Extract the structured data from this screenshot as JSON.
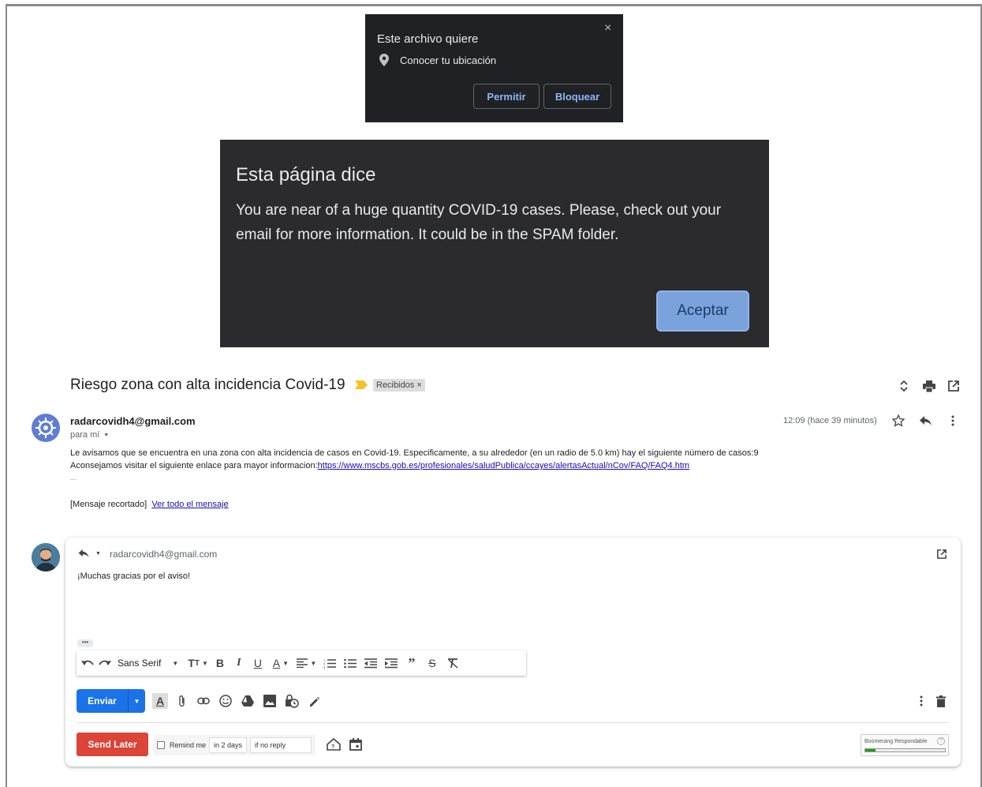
{
  "permission_popup": {
    "title": "Este archivo quiere",
    "request": "Conocer tu ubicación",
    "allow_label": "Permitir",
    "block_label": "Bloquear",
    "close_glyph": "×"
  },
  "alert_dialog": {
    "title": "Esta página dice",
    "message": "You are near of a huge quantity COVID-19 cases. Please, check out your email for more information. It could be in the SPAM folder.",
    "ok_label": "Aceptar",
    "button_color": "#7aa3dc"
  },
  "email": {
    "subject": "Riesgo zona con alta incidencia Covid-19",
    "label": "Recibidos ×",
    "sender": "radarcovidh4@gmail.com",
    "to": "para mí",
    "time": "12:09 (hace 39 minutos)",
    "body_line1": "Le avisamos que se encuentra en una zona con alta incidencia de casos en Covid-19. Especificamente, a su alrededor (en un radio de 5.0 km) hay el siguiente número de casos:9",
    "body_line2_prefix": "Aconsejamos visitar el siguiente enlace para mayor informacion:",
    "body_link": "https://www.mscbs.gob.es/profesionales/saludPublica/ccayes/alertasActual/nCov/FAQ/FAQ4.htm",
    "ellipsis": "...",
    "clipped_prefix": "[Mensaje recortado]",
    "view_all_link": "Ver todo el mensaje",
    "important_color": "#f6c026"
  },
  "reply": {
    "to": "radarcovidh4@gmail.com",
    "text": "¡Muchas gracias por el aviso!",
    "more_dots": "•••",
    "font_name": "Sans Serif",
    "send_label": "Enviar",
    "send_later_label": "Send Later",
    "remind_label": "Remind me",
    "remind_days": "in 2 days",
    "remind_condition": "if no reply",
    "boomerang_label": "Boomerang Respondable",
    "boomerang_level": 0.13,
    "send_color": "#1a73e8",
    "send_later_color": "#db4437"
  }
}
